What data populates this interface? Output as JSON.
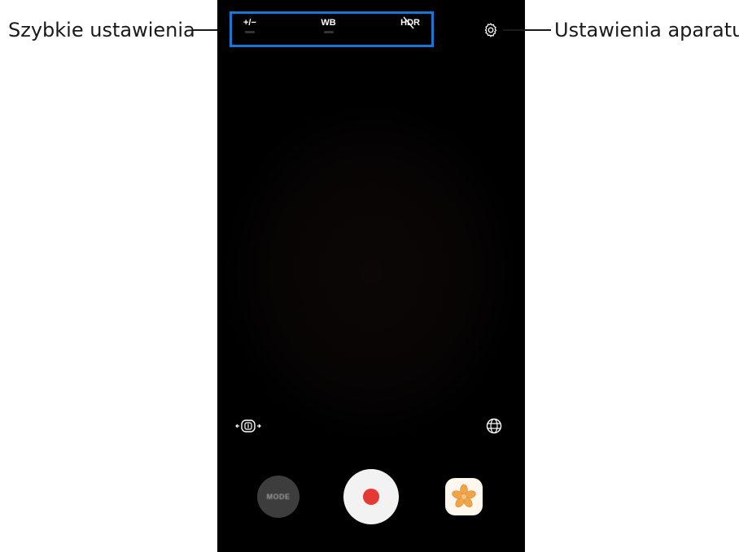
{
  "callouts": {
    "left": "Szybkie ustawienia",
    "right": "Ustawienia aparatu"
  },
  "quick_settings": {
    "items": [
      {
        "label": "+/−",
        "icon": "exposure-icon"
      },
      {
        "label": "WB",
        "icon": "white-balance-icon"
      },
      {
        "label": "HDR",
        "icon": "hdr-off-icon"
      }
    ]
  },
  "controls": {
    "settings_icon": "gear-icon",
    "stabilization_icon": "video-stabilization-icon",
    "grid_icon": "grid-globe-icon",
    "mode_label": "MODE",
    "record_icon": "record-icon",
    "gallery_icon": "gallery-flower-icon"
  },
  "colors": {
    "highlight_border": "#1976d2",
    "record_dot": "#e53935",
    "gallery_flower": "#f0a44a"
  }
}
